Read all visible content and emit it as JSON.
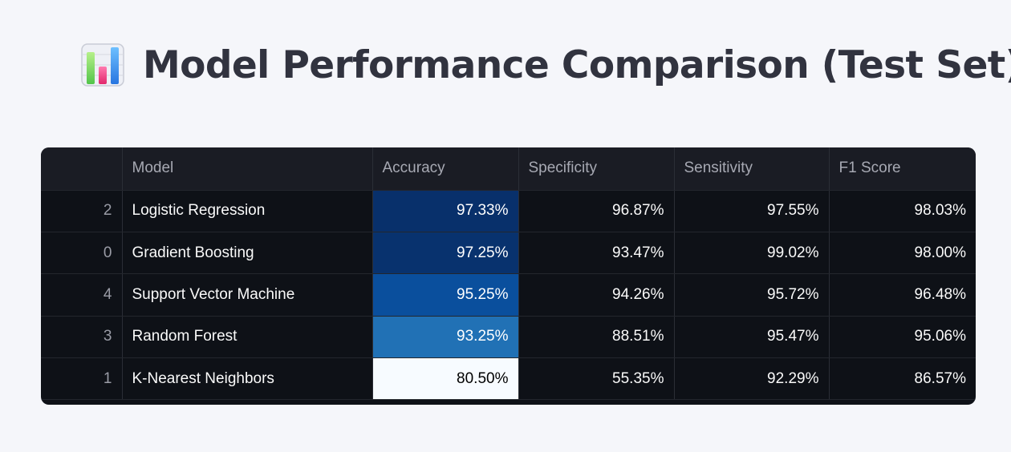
{
  "header": {
    "title": "Model Performance Comparison (Test Set)",
    "icon": "bar-chart-icon"
  },
  "table": {
    "columns": [
      "",
      "Model",
      "Accuracy",
      "Specificity",
      "Sensitivity",
      "F1 Score"
    ],
    "rows": [
      {
        "index": "2",
        "model": "Logistic Regression",
        "accuracy": "97.33%",
        "specificity": "96.87%",
        "sensitivity": "97.55%",
        "f1": "98.03%",
        "accuracy_bg": "#08306b",
        "accuracy_fg": "#ffffff"
      },
      {
        "index": "0",
        "model": "Gradient Boosting",
        "accuracy": "97.25%",
        "specificity": "93.47%",
        "sensitivity": "99.02%",
        "f1": "98.00%",
        "accuracy_bg": "#08326e",
        "accuracy_fg": "#ffffff"
      },
      {
        "index": "4",
        "model": "Support Vector Machine",
        "accuracy": "95.25%",
        "specificity": "94.26%",
        "sensitivity": "95.72%",
        "f1": "96.48%",
        "accuracy_bg": "#0a4f9d",
        "accuracy_fg": "#ffffff"
      },
      {
        "index": "3",
        "model": "Random Forest",
        "accuracy": "93.25%",
        "specificity": "88.51%",
        "sensitivity": "95.47%",
        "f1": "95.06%",
        "accuracy_bg": "#2171b5",
        "accuracy_fg": "#ffffff"
      },
      {
        "index": "1",
        "model": "K-Nearest Neighbors",
        "accuracy": "80.50%",
        "specificity": "55.35%",
        "sensitivity": "92.29%",
        "f1": "86.57%",
        "accuracy_bg": "#f7fbff",
        "accuracy_fg": "#000000"
      }
    ]
  }
}
